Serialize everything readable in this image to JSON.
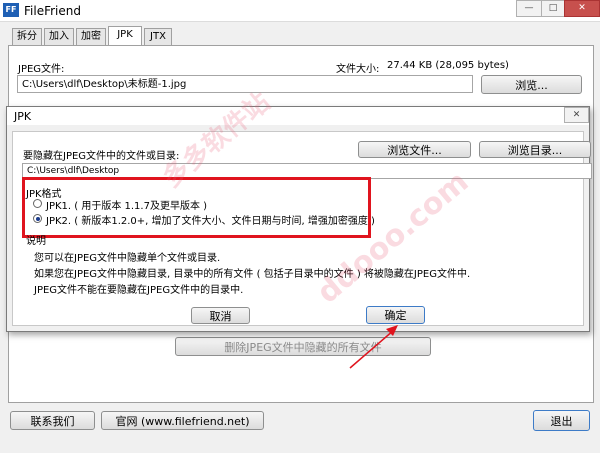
{
  "app": {
    "icon_text": "FF",
    "title": "FileFriend"
  },
  "titlebar": {
    "minimize": "—",
    "maximize": "□",
    "close": "✕"
  },
  "tabs": [
    "拆分",
    "加入",
    "加密",
    "JPK",
    "JTX"
  ],
  "main": {
    "jpeg_label": "JPEG文件:",
    "size_label": "文件大小:",
    "size_value": "27.44 KB (28,095 bytes)",
    "path_value": "C:\\Users\\dlf\\Desktop\\未标题-1.jpg",
    "browse_button": "浏览...",
    "remove_all_button": "删除JPEG文件中隐藏的所有文件",
    "contact_button": "联系我们",
    "website_button": "官网 (www.filefriend.net)",
    "exit_button": "退出"
  },
  "dialog": {
    "title": "JPK",
    "close": "✕",
    "hide_label": "要隐藏在JPEG文件中的文件或目录:",
    "browse_file_button": "浏览文件...",
    "browse_dir_button": "浏览目录...",
    "path_value": "C:\\Users\\dlf\\Desktop",
    "format_label": "JPK格式",
    "option1": "JPK1. ( 用于版本 1.1.7及更早版本 )",
    "option2": "JPK2. ( 新版本1.2.0+, 增加了文件大小、文件日期与时间, 增强加密强度 )",
    "selected_option": "JPK2",
    "desc_label": "说明",
    "desc_lines": [
      "您可以在JPEG文件中隐藏单个文件或目录.",
      "如果您在JPEG文件中隐藏目录, 目录中的所有文件 ( 包括子目录中的文件 ) 将被隐藏在JPEG文件中.",
      "JPEG文件不能在要隐藏在JPEG文件中的目录中."
    ],
    "cancel_button": "取消",
    "ok_button": "确定"
  },
  "watermark": {
    "line1": "多多软件站",
    "line2": "ddooo.com"
  },
  "colors": {
    "highlight": "#e0141e",
    "arrow": "#e0141e",
    "accent": "#1e5fb4"
  }
}
